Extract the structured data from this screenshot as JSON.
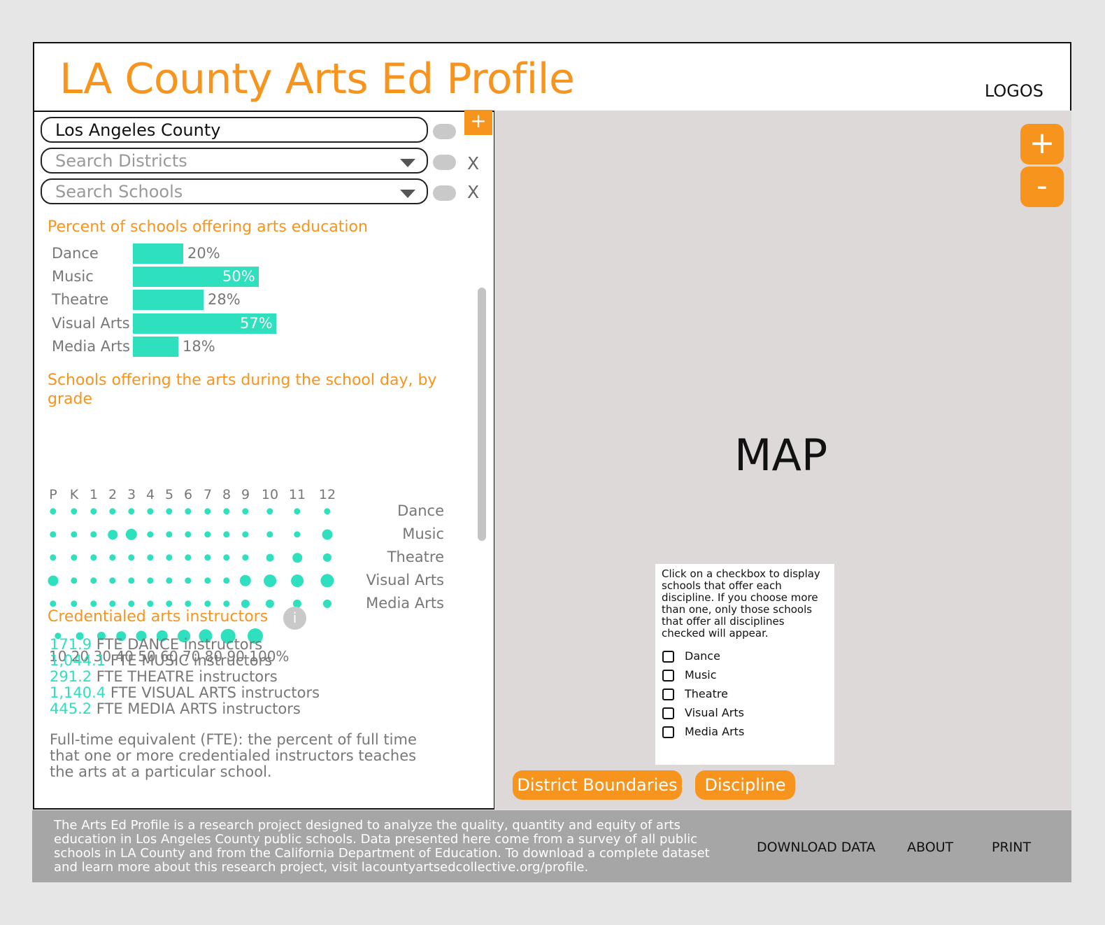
{
  "header": {
    "title": "LA County Arts Ed Profile",
    "logos": "LOGOS"
  },
  "filters": {
    "county": "Los Angeles County",
    "districts_placeholder": "Search Districts",
    "schools_placeholder": "Search Schools",
    "add_label": "+",
    "clear_label": "X"
  },
  "percent_section": {
    "title": "Percent of schools offering arts education",
    "bars": [
      {
        "label": "Dance",
        "value": 20,
        "display": "20%"
      },
      {
        "label": "Music",
        "value": 50,
        "display": "50%"
      },
      {
        "label": "Theatre",
        "value": 28,
        "display": "28%"
      },
      {
        "label": "Visual Arts",
        "value": 57,
        "display": "57%"
      },
      {
        "label": "Media Arts",
        "value": 18,
        "display": "18%"
      }
    ]
  },
  "grade_section": {
    "title": "Schools offering the arts during the school day, by grade",
    "grades": [
      "P",
      "K",
      "1",
      "2",
      "3",
      "4",
      "5",
      "6",
      "7",
      "8",
      "9",
      "10",
      "11",
      "12"
    ],
    "rows": [
      {
        "label": "Dance",
        "levels": [
          10,
          10,
          10,
          10,
          10,
          10,
          10,
          10,
          10,
          10,
          10,
          10,
          10,
          10
        ]
      },
      {
        "label": "Music",
        "levels": [
          10,
          10,
          10,
          40,
          60,
          10,
          10,
          10,
          10,
          10,
          10,
          10,
          10,
          50
        ]
      },
      {
        "label": "Theatre",
        "levels": [
          10,
          10,
          10,
          10,
          10,
          10,
          10,
          10,
          10,
          10,
          10,
          20,
          40,
          30
        ]
      },
      {
        "label": "Visual Arts",
        "levels": [
          50,
          10,
          10,
          10,
          10,
          10,
          10,
          10,
          10,
          10,
          60,
          70,
          70,
          80
        ]
      },
      {
        "label": "Media Arts",
        "levels": [
          10,
          10,
          10,
          10,
          10,
          10,
          10,
          10,
          10,
          10,
          30,
          30,
          30,
          30
        ]
      }
    ],
    "legend_levels": [
      10,
      20,
      30,
      40,
      50,
      60,
      70,
      80,
      90,
      100
    ],
    "legend_text": "10 20 30 40 50 60 70 80 90 100%"
  },
  "instructors": {
    "title": "Credentialed arts instructors",
    "info_icon": "i",
    "items": [
      {
        "num": "171.9",
        "text": " FTE DANCE instructors"
      },
      {
        "num": "1,044.1",
        "text": " FTE MUSIC instructors"
      },
      {
        "num": "291.2",
        "text": " FTE THEATRE instructors"
      },
      {
        "num": "1,140.4",
        "text": " FTE VISUAL ARTS instructors"
      },
      {
        "num": "445.2",
        "text": " FTE MEDIA ARTS instructors"
      }
    ],
    "note": "Full-time equivalent (FTE): the percent of full time that one or more credentialed instructors teaches the arts at a particular school."
  },
  "map": {
    "label": "MAP",
    "zoom_in": "+",
    "zoom_out": "-",
    "panel_text": "Click on a checkbox to display schools that offer each discipline. If you choose more than one, only those schools that offer all disciplines checked will appear.",
    "disciplines": [
      "Dance",
      "Music",
      "Theatre",
      "Visual Arts",
      "Media Arts"
    ],
    "buttons": {
      "district_boundaries": "District Boundaries",
      "discipline": "Discipline"
    }
  },
  "footer": {
    "text": "The Arts Ed Profile is a research project designed to analyze the quality, quantity and equity of arts education in Los Angeles County public schools. Data presented here come from a survey of all public schools in LA County and from the California Department of Education. To download a complete dataset and learn more about this research project, visit lacountyartsedcollective.org/profile.",
    "links": {
      "download": "DOWNLOAD DATA",
      "about": "ABOUT",
      "print": "PRINT"
    }
  },
  "colors": {
    "accent": "#f7941d",
    "teal": "#2ee0bd",
    "muted_text": "#777777",
    "map_bg": "#dcd9d8",
    "footer_bg": "#a6a6a6"
  }
}
